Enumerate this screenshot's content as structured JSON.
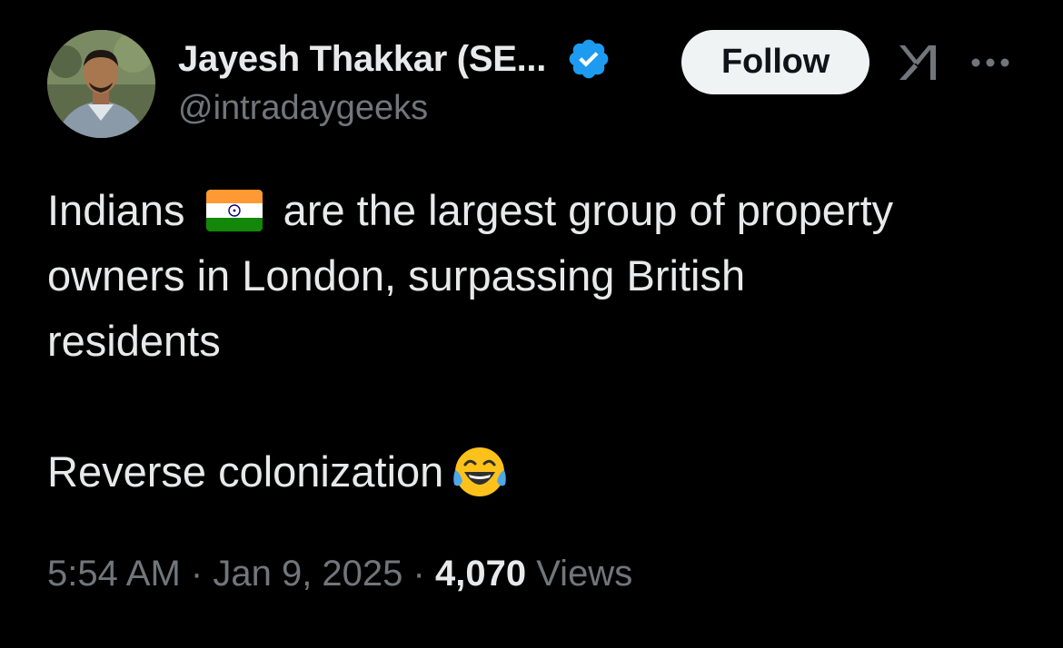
{
  "author": {
    "display_name": "Jayesh Thakkar (SE...",
    "handle": "@intradaygeeks",
    "avatar": "avatar-photo",
    "verified_icon": "verified-badge-icon"
  },
  "actions": {
    "follow_label": "Follow",
    "grok_icon": "grok-icon",
    "more_icon": "more-options-icon"
  },
  "tweet": {
    "line1_before_flag": "Indians",
    "flag_emoji": "india-flag-emoji",
    "line1_after_flag": "are the largest group of property",
    "line2": "owners in London, surpassing British",
    "line3": "residents",
    "line4": "Reverse colonization",
    "end_emoji": "face-with-tears-of-joy-emoji"
  },
  "meta": {
    "time": "5:54 AM",
    "date": "Jan 9, 2025",
    "separator": "·",
    "views_count": "4,070",
    "views_label": "Views"
  },
  "colors": {
    "background": "#000000",
    "text_primary": "#e7e9ea",
    "text_secondary": "#71767b",
    "verified_blue": "#1d9bf0",
    "follow_bg": "#eff3f4"
  }
}
